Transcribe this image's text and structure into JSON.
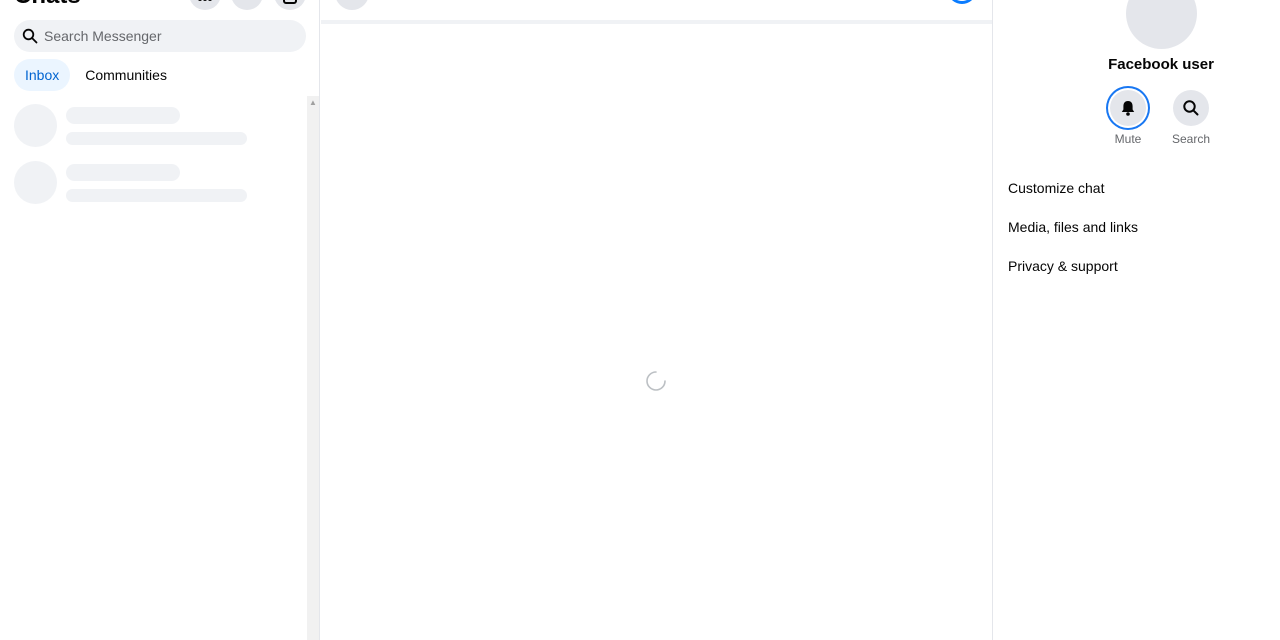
{
  "sidebar": {
    "title": "Chats",
    "search": {
      "placeholder": "Search Messenger",
      "value": ""
    },
    "tabs": [
      {
        "label": "Inbox",
        "active": true
      },
      {
        "label": "Communities",
        "active": false
      }
    ]
  },
  "conversation": {
    "state": "loading"
  },
  "details": {
    "name": "Facebook user",
    "actions": [
      {
        "label": "Mute",
        "icon": "bell-icon"
      },
      {
        "label": "Search",
        "icon": "search-icon"
      }
    ],
    "menu": [
      {
        "label": "Customize chat"
      },
      {
        "label": "Media, files and links"
      },
      {
        "label": "Privacy & support"
      }
    ]
  },
  "colors": {
    "accent": "#0064d1",
    "active_tab_bg": "#ebf5ff",
    "skeleton": "#f0f2f5",
    "ring": "#1877f2"
  }
}
